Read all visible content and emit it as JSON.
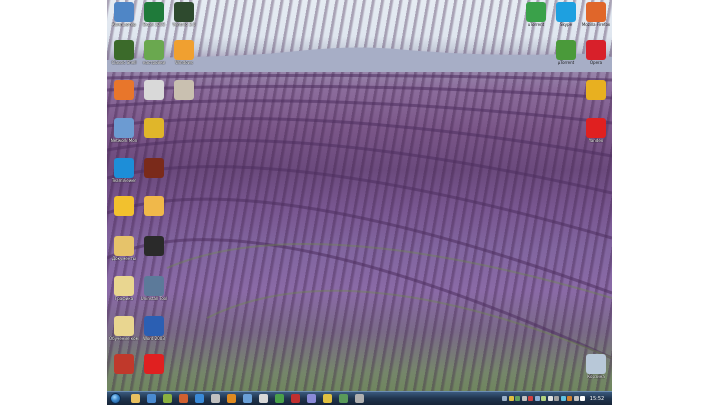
{
  "desktop": {
    "wallpaper": "lavender-field",
    "left_icons": [
      {
        "label": "Компьютер",
        "icon": "computer-icon",
        "color": "#4f86c6"
      },
      {
        "label": "Excel 2003",
        "icon": "excel-icon",
        "color": "#1f7a3a"
      },
      {
        "label": "Ventrilo 3.0",
        "icon": "headset-icon",
        "color": "#2e4a2e"
      },
      {
        "label": "Classic Shell",
        "icon": "shell-icon",
        "color": "#3b6a2a"
      },
      {
        "label": "настройки",
        "icon": "settings-icon",
        "color": "#6aa84f"
      },
      {
        "label": "Windows",
        "icon": "windows-orb-icon",
        "color": "#f0a030"
      },
      {
        "label": "",
        "icon": "app-icon-orange",
        "color": "#e8762b"
      },
      {
        "label": "",
        "icon": "barcode-icon",
        "color": "#d9d9d9"
      },
      {
        "label": "",
        "icon": "picture-icon",
        "color": "#c9c0b0"
      },
      {
        "label": "Network Mon",
        "icon": "network-icon",
        "color": "#6c9bd2"
      },
      {
        "label": "",
        "icon": "chart-app-icon",
        "color": "#e0b62a"
      },
      {
        "label": "TeamViewer",
        "icon": "teamviewer-icon",
        "color": "#1d8ed8"
      },
      {
        "label": "",
        "icon": "avatar-icon",
        "color": "#7a2a1a"
      },
      {
        "label": "",
        "icon": "chat-icon",
        "color": "#f2c12e"
      },
      {
        "label": "",
        "icon": "folder-icon",
        "color": "#f0b84a"
      },
      {
        "label": "Документы",
        "icon": "documents-icon",
        "color": "#e6c36a"
      },
      {
        "label": "",
        "icon": "dark-app-icon",
        "color": "#2a2a2a"
      },
      {
        "label": "Графика",
        "icon": "graphics-folder-icon",
        "color": "#e9d690"
      },
      {
        "label": "Uninstall Tool",
        "icon": "uninstall-icon",
        "color": "#5c7a9a"
      },
      {
        "label": "Обучение компьютеру",
        "icon": "folder-icon",
        "color": "#e9d690"
      },
      {
        "label": "Word 2003",
        "icon": "word-icon",
        "color": "#2b5fb3"
      },
      {
        "label": "",
        "icon": "red-app-icon",
        "color": "#c0392b"
      },
      {
        "label": "",
        "icon": "yandex-app-icon",
        "color": "#e02020"
      }
    ],
    "right_icons": [
      {
        "label": "uTorrent",
        "icon": "people-icon",
        "color": "#3aa14a"
      },
      {
        "label": "Skype",
        "icon": "skype-icon",
        "color": "#1ea0e0"
      },
      {
        "label": "Mozilla Firefox",
        "icon": "firefox-icon",
        "color": "#e0662a"
      },
      {
        "label": "µTorrent",
        "icon": "utorrent-icon",
        "color": "#4a9a3a"
      },
      {
        "label": "Opera",
        "icon": "opera-icon",
        "color": "#d8202a"
      },
      {
        "label": "",
        "icon": "chrome-icon",
        "color": "#e8b020"
      },
      {
        "label": "Yandex",
        "icon": "yandex-icon",
        "color": "#e02020"
      },
      {
        "label": "Корзина",
        "icon": "recycle-bin-icon",
        "color": "#b8c8d8"
      }
    ]
  },
  "taskbar": {
    "start": "start-orb-icon",
    "pinned": [
      {
        "icon": "explorer-icon",
        "color": "#e8c060"
      },
      {
        "icon": "media-icon",
        "color": "#4a8ad0"
      },
      {
        "icon": "app-icon",
        "color": "#8ab040"
      },
      {
        "icon": "app-icon",
        "color": "#d06030"
      },
      {
        "icon": "ie-icon",
        "color": "#3a8ad8"
      },
      {
        "icon": "app-icon",
        "color": "#c0c0c0"
      },
      {
        "icon": "app-icon",
        "color": "#e08a20"
      },
      {
        "icon": "app-icon",
        "color": "#6aa0d8"
      },
      {
        "icon": "app-icon",
        "color": "#d8d8d8"
      },
      {
        "icon": "app-icon",
        "color": "#4aa04a"
      },
      {
        "icon": "app-icon",
        "color": "#c03030"
      },
      {
        "icon": "app-icon",
        "color": "#8a8ad8"
      },
      {
        "icon": "app-icon",
        "color": "#e0c040"
      },
      {
        "icon": "app-icon",
        "color": "#5a9a5a"
      },
      {
        "icon": "app-icon",
        "color": "#b0b0b0"
      }
    ],
    "tray_colors": [
      "#9ab0c8",
      "#e0c040",
      "#60a060",
      "#c0c0c0",
      "#d04040",
      "#8ab0d8",
      "#b0d080",
      "#e0e0e0",
      "#a0a0a0",
      "#60c0e0",
      "#d08030",
      "#c0c0c0",
      "#ffffff"
    ],
    "clock": "15:52"
  }
}
